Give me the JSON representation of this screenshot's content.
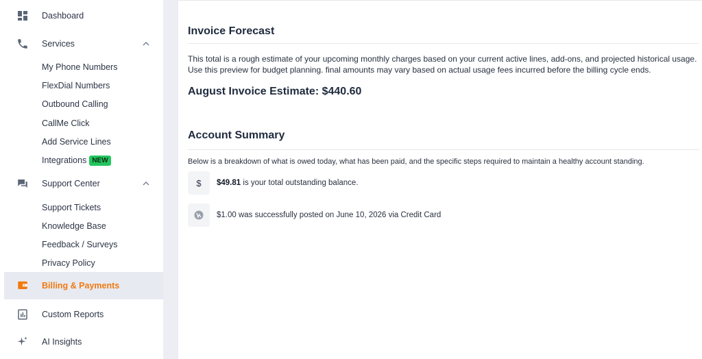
{
  "sidebar": {
    "dashboard": "Dashboard",
    "services": {
      "label": "Services",
      "items": [
        "My Phone Numbers",
        "FlexDial Numbers",
        "Outbound Calling",
        "CallMe Click",
        "Add Service Lines",
        "Integrations"
      ],
      "integrations_badge": "NEW"
    },
    "support": {
      "label": "Support Center",
      "items": [
        "Support Tickets",
        "Knowledge Base",
        "Feedback / Surveys",
        "Privacy Policy"
      ]
    },
    "billing": "Billing & Payments",
    "reports": "Custom Reports",
    "ai": "AI Insights"
  },
  "forecast": {
    "title": "Invoice Forecast",
    "description": "This total is a rough estimate of your upcoming monthly charges based on your current active lines, add-ons, and projected historical usage. Use this preview for budget planning. final amounts may vary based on actual usage fees incurred before the billing cycle ends.",
    "estimate": "August Invoice Estimate: $440.60"
  },
  "summary": {
    "title": "Account Summary",
    "description": "Below is a breakdown of what is owed today, what has been paid, and the specific steps required to maintain a healthy account standing.",
    "balance_icon": "$",
    "balance_amount": "$49.81",
    "balance_text": " is your total outstanding balance.",
    "payment_text": "$1.00 was successfully posted on June 10, 2026 via Credit Card"
  },
  "colors": {
    "accent": "#f07a12",
    "badge": "#22c55e",
    "active_bg": "#e8eaf1"
  },
  "icons": {
    "dashboard": "dashboard-icon",
    "services": "phone-icon",
    "support": "chat-icon",
    "billing": "wallet-icon",
    "reports": "report-icon",
    "ai": "sparkle-icon",
    "payment": "card-icon"
  }
}
